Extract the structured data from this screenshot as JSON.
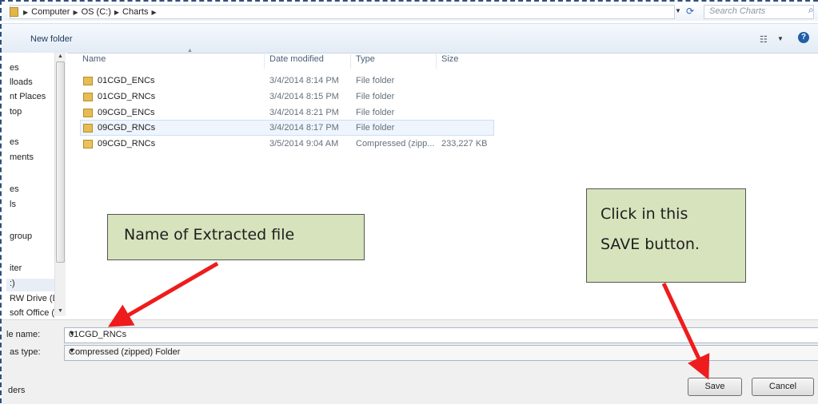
{
  "address_bar": {
    "breadcrumbs": [
      "Computer",
      "OS (C:)",
      "Charts"
    ],
    "search_placeholder": "Search Charts"
  },
  "toolbar": {
    "new_folder": "New folder"
  },
  "nav_pane": {
    "items": [
      "es",
      "lloads",
      "nt Places",
      "top",
      "es",
      "ments",
      "es",
      "ls",
      "group",
      "iter",
      ":)",
      "RW Drive (D",
      "soft Office ("
    ]
  },
  "file_list": {
    "columns": [
      "Name",
      "Date modified",
      "Type",
      "Size"
    ],
    "rows": [
      {
        "name": "01CGD_ENCs",
        "date": "3/4/2014 8:14 PM",
        "type": "File folder",
        "size": ""
      },
      {
        "name": "01CGD_RNCs",
        "date": "3/4/2014 8:15 PM",
        "type": "File folder",
        "size": ""
      },
      {
        "name": "09CGD_ENCs",
        "date": "3/4/2014 8:21 PM",
        "type": "File folder",
        "size": ""
      },
      {
        "name": "09CGD_RNCs",
        "date": "3/4/2014 8:17 PM",
        "type": "File folder",
        "size": ""
      },
      {
        "name": "09CGD_RNCs",
        "date": "3/5/2014 9:04 AM",
        "type": "Compressed (zipp...",
        "size": "233,227 KB"
      }
    ]
  },
  "bottom": {
    "filename_label": "le name:",
    "filename_value": "01CGD_RNCs",
    "filetype_label": "as type:",
    "filetype_value": "Compressed (zipped) Folder",
    "save": "Save",
    "cancel": "Cancel",
    "folders_toggle": "ders"
  },
  "annotations": {
    "callout_1": "Name of Extracted file",
    "callout_2_line1": "Click in this",
    "callout_2_line2": "SAVE button.",
    "arrow_color": "#ee1c1c"
  }
}
